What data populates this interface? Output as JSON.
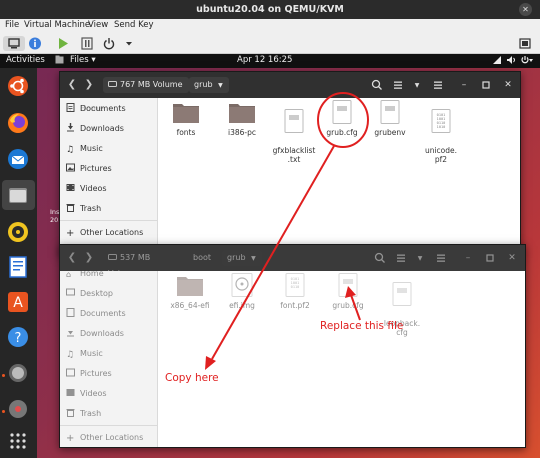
{
  "host": {
    "title": "ubuntu20.04 on QEMU/KVM",
    "menu": [
      "File",
      "Virtual Machine",
      "View",
      "Send Key"
    ]
  },
  "topbar": {
    "activities": "Activities",
    "app": "Files ▾",
    "clock": "Apr 12  16:25"
  },
  "desktop": {
    "label_line1": "Ins",
    "label_line2": "20."
  },
  "window1": {
    "volume": "767 MB Volume",
    "crumb": "grub",
    "sidebar": [
      "Home",
      "Documents",
      "Downloads",
      "Music",
      "Pictures",
      "Videos",
      "Trash",
      "Other Locations"
    ],
    "files": [
      {
        "name": "fonts",
        "kind": "folder"
      },
      {
        "name": "i386-pc",
        "kind": "folder"
      },
      {
        "name": "gfxblacklist\n.txt",
        "kind": "doc"
      },
      {
        "name": "grub.cfg",
        "kind": "doc"
      },
      {
        "name": "grubenv",
        "kind": "doc"
      },
      {
        "name": "unicode.\npf2",
        "kind": "bin"
      }
    ]
  },
  "window2": {
    "volume": "537 MB Volume",
    "crumb1": "boot",
    "crumb2": "grub",
    "sidebar": [
      "Home",
      "Desktop",
      "Documents",
      "Downloads",
      "Music",
      "Pictures",
      "Videos",
      "Trash",
      "Other Locations"
    ],
    "files": [
      {
        "name": "x86_64-efi",
        "kind": "folder"
      },
      {
        "name": "efi.img",
        "kind": "disk"
      },
      {
        "name": "font.pf2",
        "kind": "bin"
      },
      {
        "name": "grub.cfg",
        "kind": "doc"
      },
      {
        "name": "loopback.\ncfg",
        "kind": "doc"
      }
    ]
  },
  "annotations": {
    "copy_here": "Copy here",
    "replace": "Replace this file",
    "color": "#e02020"
  }
}
